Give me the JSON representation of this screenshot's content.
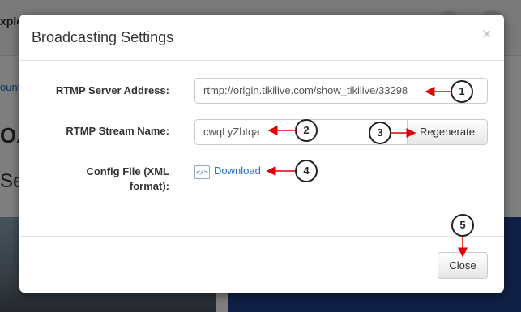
{
  "background": {
    "header_fragment": "xploi",
    "link_fragment": "ount",
    "heading_fragment": "OA",
    "subheading_fragment": "Se"
  },
  "modal": {
    "title": "Broadcasting Settings",
    "close_icon": "×",
    "fields": {
      "server_label": "RTMP Server Address:",
      "server_value": "rtmp://origin.tikilive.com/show_tikilive/33298",
      "stream_label": "RTMP Stream Name:",
      "stream_value": "cwqLyZbtqa",
      "regenerate_label": "Regenerate",
      "config_label": "Config File (XML format):",
      "config_icon": "</>",
      "download_label": "Download"
    },
    "close_button_label": "Close"
  },
  "annotations": [
    "1",
    "2",
    "3",
    "4",
    "5"
  ],
  "colors": {
    "arrow": "#e00000",
    "link": "#2a6ebb"
  }
}
